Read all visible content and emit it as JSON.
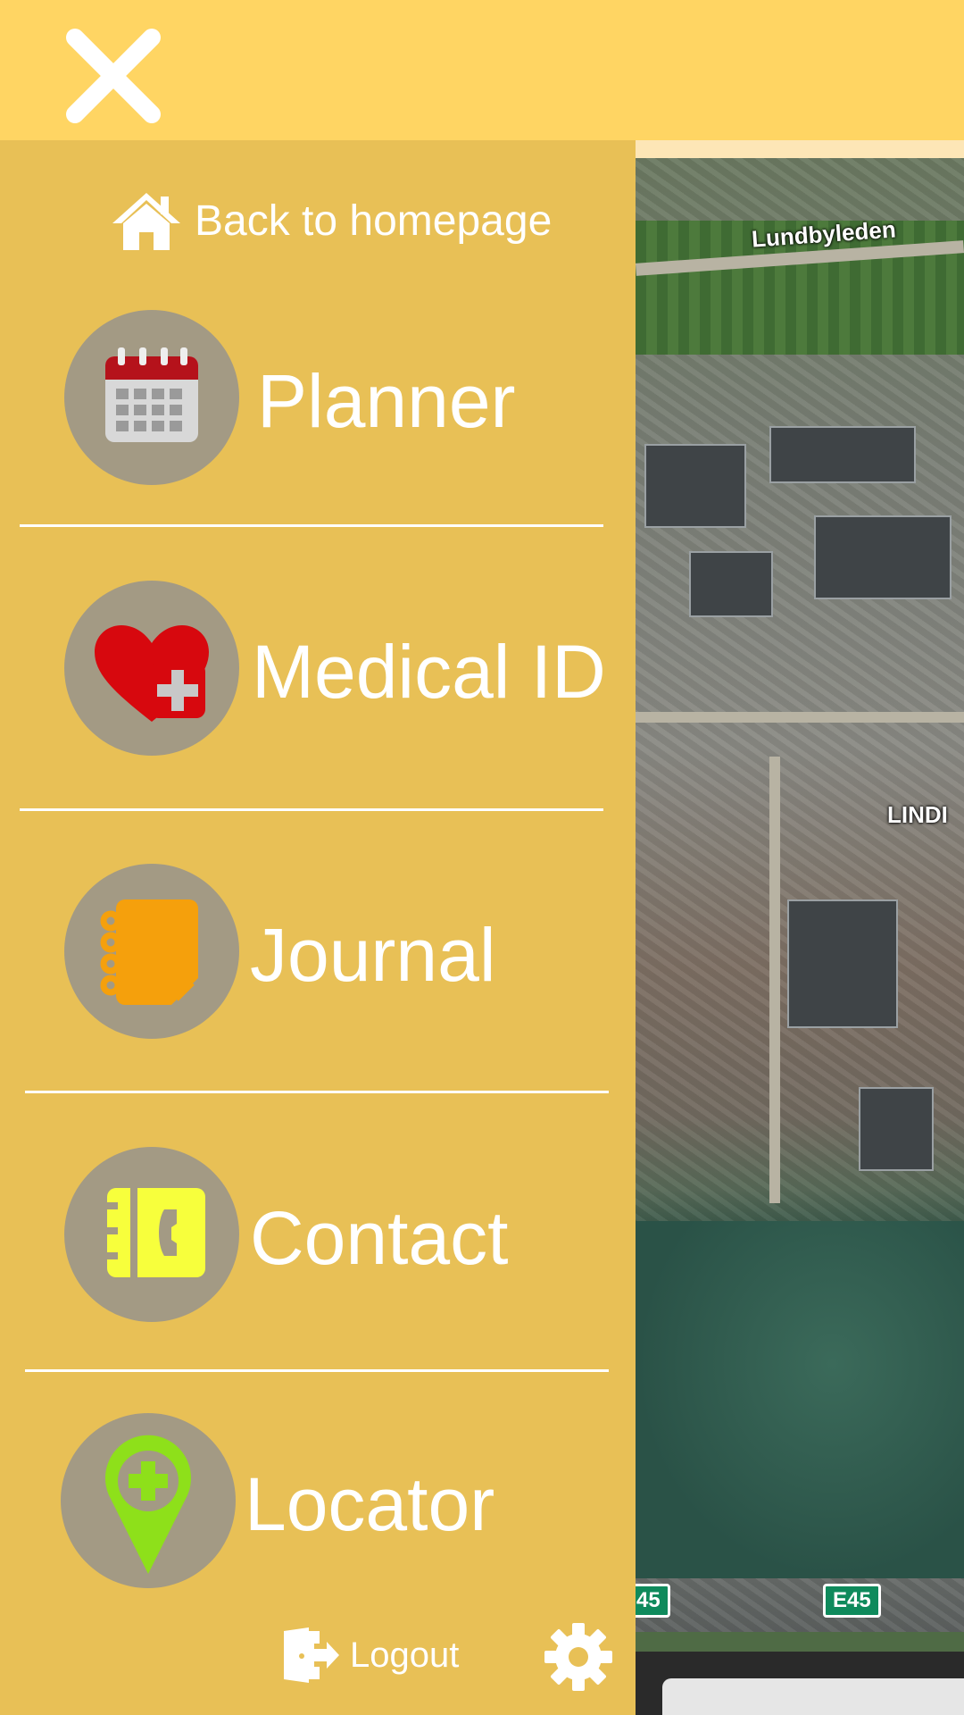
{
  "header": {
    "close_icon": "close-icon"
  },
  "drawer": {
    "home_link": {
      "label": "Back to homepage",
      "icon": "home-icon"
    },
    "items": [
      {
        "label": "Planner",
        "icon": "calendar-icon"
      },
      {
        "label": "Medical ID",
        "icon": "heart-plus-icon"
      },
      {
        "label": "Journal",
        "icon": "notebook-icon"
      },
      {
        "label": "Contact",
        "icon": "contact-book-icon"
      },
      {
        "label": "Locator",
        "icon": "location-pin-plus-icon"
      }
    ],
    "logout": {
      "label": "Logout",
      "icon": "logout-icon"
    },
    "settings": {
      "icon": "gear-icon"
    }
  },
  "map": {
    "labels": [
      "Lundbyleden",
      "LINDI"
    ],
    "road_signs": [
      "45",
      "E45"
    ]
  },
  "colors": {
    "topbar": "#ffd563",
    "drawer": "#e8c056",
    "icon_circle": "#a39a84"
  }
}
